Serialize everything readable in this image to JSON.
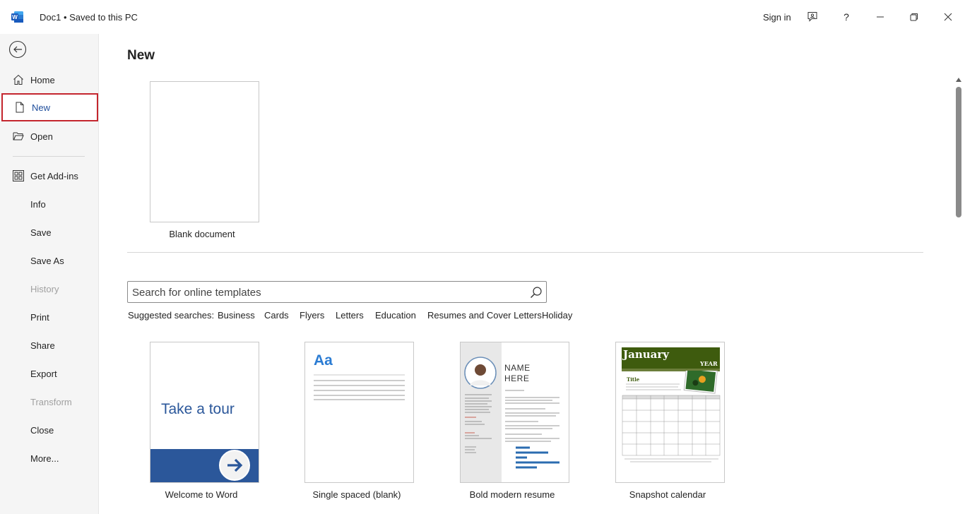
{
  "titlebar": {
    "app_icon": "word-logo-icon",
    "doc_title": "Doc1  •  Saved to this PC",
    "signin_label": "Sign in",
    "feedback_icon": "feedback-icon",
    "help_label": "?",
    "minimize_icon": "minimize-icon",
    "restore_icon": "restore-icon",
    "close_icon": "close-icon"
  },
  "sidebar": {
    "back_icon": "back-arrow-icon",
    "items": [
      {
        "label": "Home",
        "icon": "home-icon"
      },
      {
        "label": "New",
        "icon": "new-document-icon"
      },
      {
        "label": "Open",
        "icon": "folder-open-icon"
      },
      {
        "label": "Get Add-ins",
        "icon": "add-ins-grid-icon"
      },
      {
        "label": "Info"
      },
      {
        "label": "Save"
      },
      {
        "label": "Save As"
      },
      {
        "label": "History"
      },
      {
        "label": "Print"
      },
      {
        "label": "Share"
      },
      {
        "label": "Export"
      },
      {
        "label": "Transform"
      },
      {
        "label": "Close"
      },
      {
        "label": "More..."
      }
    ]
  },
  "main": {
    "heading": "New",
    "blank_label": "Blank document",
    "search": {
      "placeholder": "Search for online templates",
      "icon": "search-icon"
    },
    "suggested_label": "Suggested searches:",
    "suggested": [
      "Business",
      "Cards",
      "Flyers",
      "Letters",
      "Education",
      "Resumes and Cover Letters",
      "Holiday"
    ],
    "templates": [
      {
        "label": "Welcome to Word",
        "thumb_text": "Take a tour"
      },
      {
        "label": "Single spaced (blank)",
        "thumb_text": "Aa"
      },
      {
        "label": "Bold modern resume",
        "thumb_text_1": "NAME",
        "thumb_text_2": "HERE"
      },
      {
        "label": "Snapshot calendar",
        "thumb_text_1": "January",
        "thumb_text_2": "YEAR",
        "thumb_text_3": "Title"
      }
    ]
  },
  "colors": {
    "accent": "#2b579a",
    "selected_border": "#c4262e",
    "calendar_header": "#3e5b0e"
  }
}
